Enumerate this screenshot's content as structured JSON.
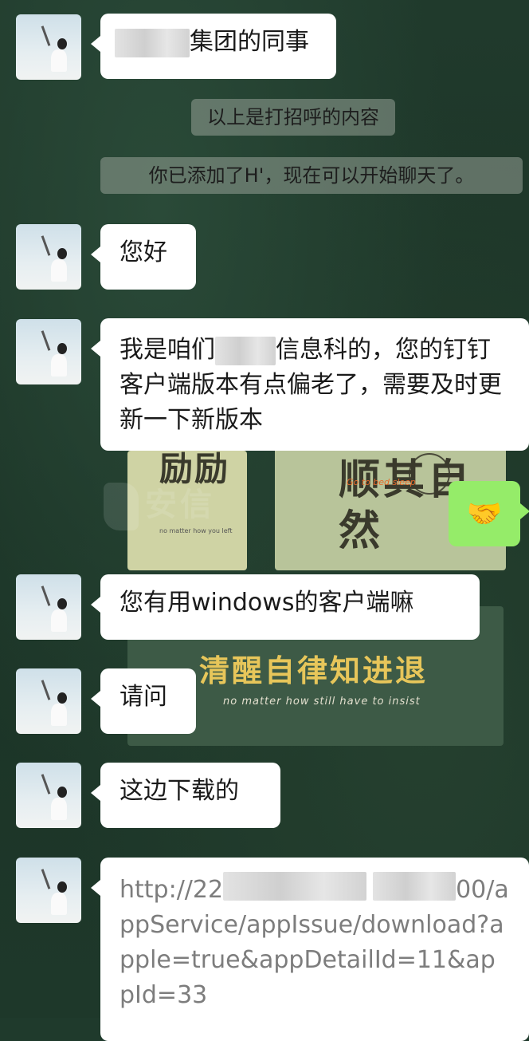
{
  "wallpaper": {
    "card1_text": "励励",
    "card1_small": "no matter how you left",
    "card2_text": "顺其自然",
    "card2_small": "Go to bed sleep",
    "card3_text": "清醒自律知进退",
    "card3_small": "no matter how still have to insist",
    "watermark": "安信"
  },
  "messages": {
    "m1": "集团的同事",
    "sys1": "以上是打招呼的内容",
    "sys2": "你已添加了H'，现在可以开始聊天了。",
    "m2": "您好",
    "m3_part1": "我是咱们",
    "m3_part2": "信息科的，您的钉钉客户端版本有点偏老了，需要及时更新一下新版本",
    "out_emoji": "🤝",
    "m4": "您有用windows的客户端嘛",
    "m5": "请问",
    "m6": "这边下载的",
    "m7_prefix": "http://22",
    "m7_mid": "00/app",
    "m7_rest": "Service/appIssue/download?apple=true&appDetailId=11&appId=33"
  }
}
